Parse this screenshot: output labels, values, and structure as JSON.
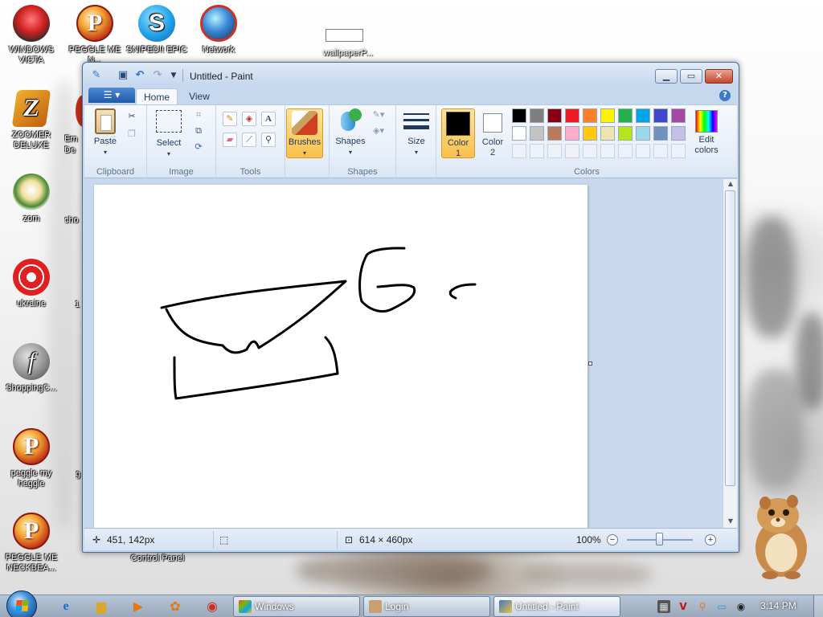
{
  "desktop": {
    "icons_left": [
      {
        "label": "WINDOWS VISTA"
      },
      {
        "label": "ZOOMER DELUXE"
      },
      {
        "label": "zom"
      },
      {
        "label": "ukraine"
      },
      {
        "label": "ShoppingC..."
      },
      {
        "label": "peggle my heggle"
      },
      {
        "label": "PEGGLE ME NECKBEA..."
      }
    ],
    "icons_top": [
      {
        "label": "PEGGLE ME N..."
      },
      {
        "label": "SNIPED!! EPIC"
      },
      {
        "label": "Network"
      }
    ],
    "partial_icons": [
      {
        "label": "Em De"
      },
      {
        "label": "cho"
      },
      {
        "label": "1"
      },
      {
        "label": "g"
      }
    ],
    "rename_label": "",
    "wallpaper_label": "wallpaperP...",
    "control_panel_label": "Control Panel"
  },
  "paint": {
    "title": "Untitled - Paint",
    "tabs": [
      "Home",
      "View"
    ],
    "groups": {
      "clipboard": {
        "label": "Clipboard",
        "paste": "Paste"
      },
      "image": {
        "label": "Image",
        "select": "Select"
      },
      "tools": {
        "label": "Tools"
      },
      "brushes": {
        "label": "Brushes"
      },
      "shapes": {
        "label": "Shapes",
        "shapes_btn": "Shapes"
      },
      "size": {
        "label": "Size"
      },
      "colors": {
        "label": "Colors",
        "color1": "Color 1",
        "color2": "Color 2",
        "edit": "Edit colors"
      }
    },
    "palette_row1": [
      "#000000",
      "#7f7f7f",
      "#880015",
      "#ed1c24",
      "#ff7f27",
      "#fff200",
      "#22b14c",
      "#00a2e8",
      "#3f48cc",
      "#a349a4"
    ],
    "palette_row2": [
      "#ffffff",
      "#c3c3c3",
      "#b97a57",
      "#ffaec9",
      "#ffc90e",
      "#efe4b0",
      "#b5e61d",
      "#99d9ea",
      "#7092be",
      "#c8bfe7"
    ],
    "color1": "#000000",
    "color2": "#ffffff",
    "status": {
      "cursor_pos": "451, 142px",
      "canvas_size": "614 × 460px",
      "zoom": "100%"
    }
  },
  "taskbar": {
    "items": [
      {
        "label": "Windows"
      },
      {
        "label": "Login"
      },
      {
        "label": "Untitled - Paint"
      }
    ],
    "clock": "3:14 PM"
  }
}
